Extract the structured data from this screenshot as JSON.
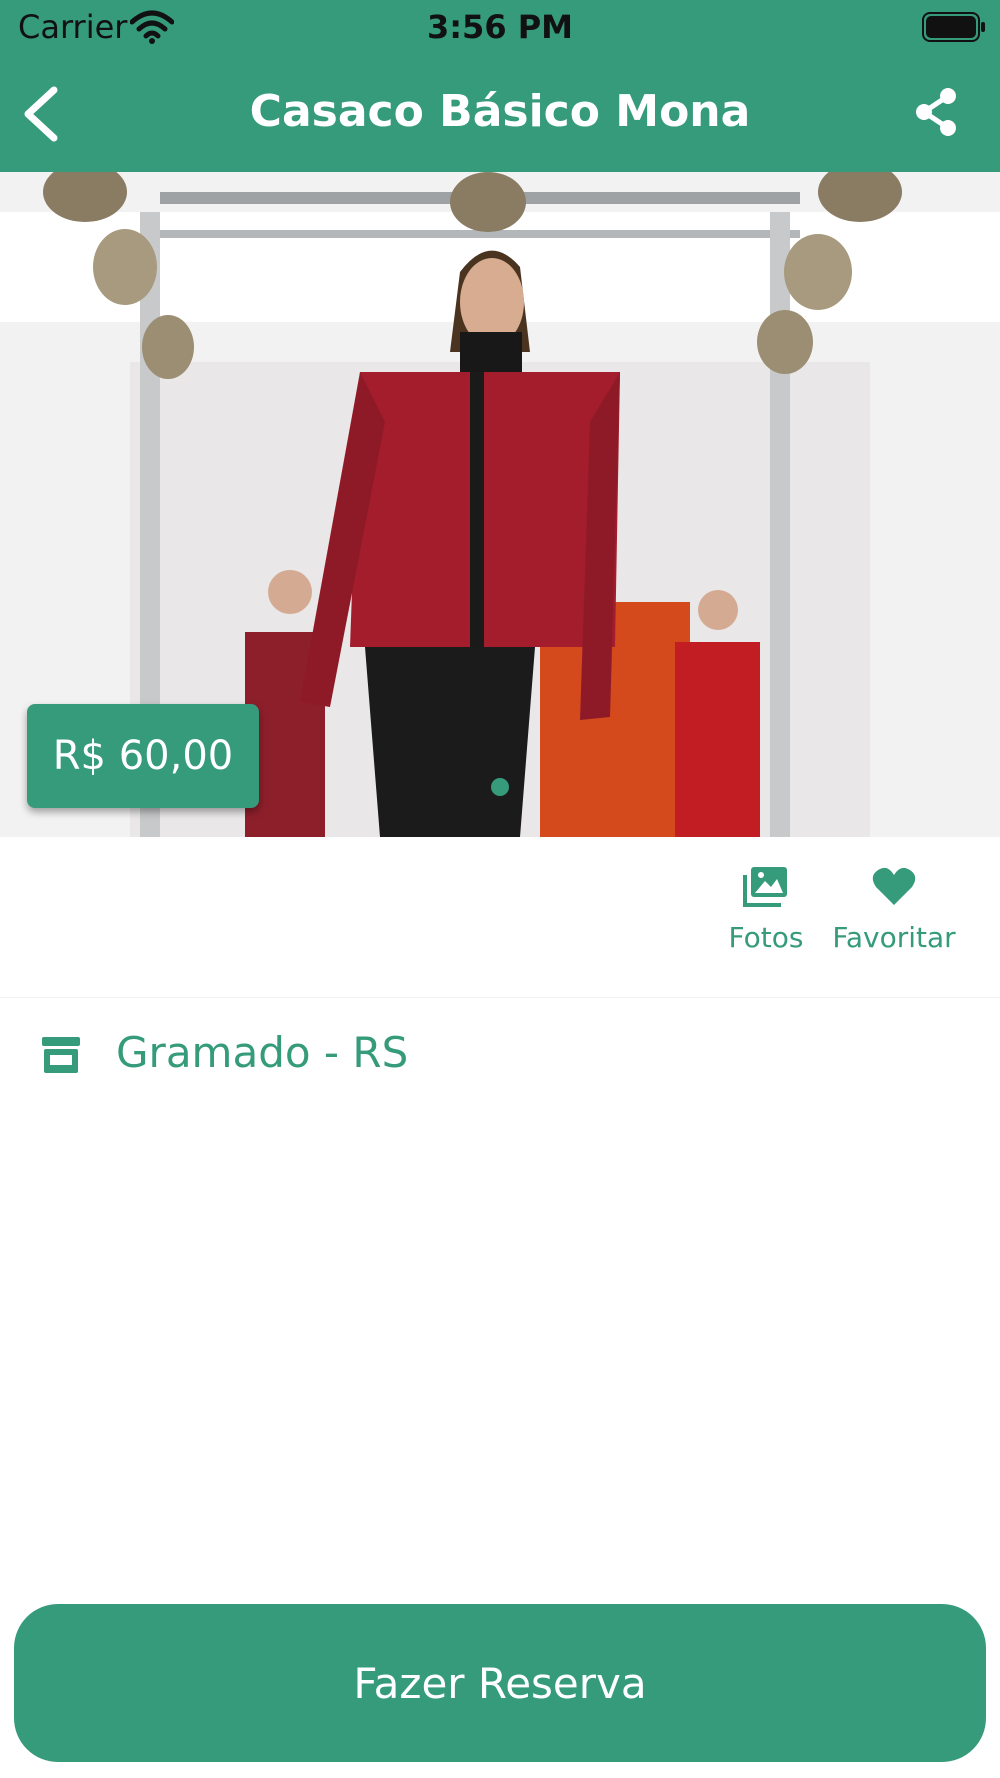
{
  "status_bar": {
    "carrier": "Carrier",
    "time": "3:56 PM"
  },
  "nav": {
    "title": "Casaco Básico Mona"
  },
  "product": {
    "price": "R$ 60,00",
    "photo_count": 1,
    "active_photo": 1
  },
  "actions": {
    "photos_label": "Fotos",
    "favorite_label": "Favoritar"
  },
  "location": {
    "text": "Gramado - RS"
  },
  "cta": {
    "label": "Fazer Reserva"
  },
  "colors": {
    "accent": "#359b7b",
    "background": "#ffffff",
    "text_on_accent": "#ffffff"
  }
}
